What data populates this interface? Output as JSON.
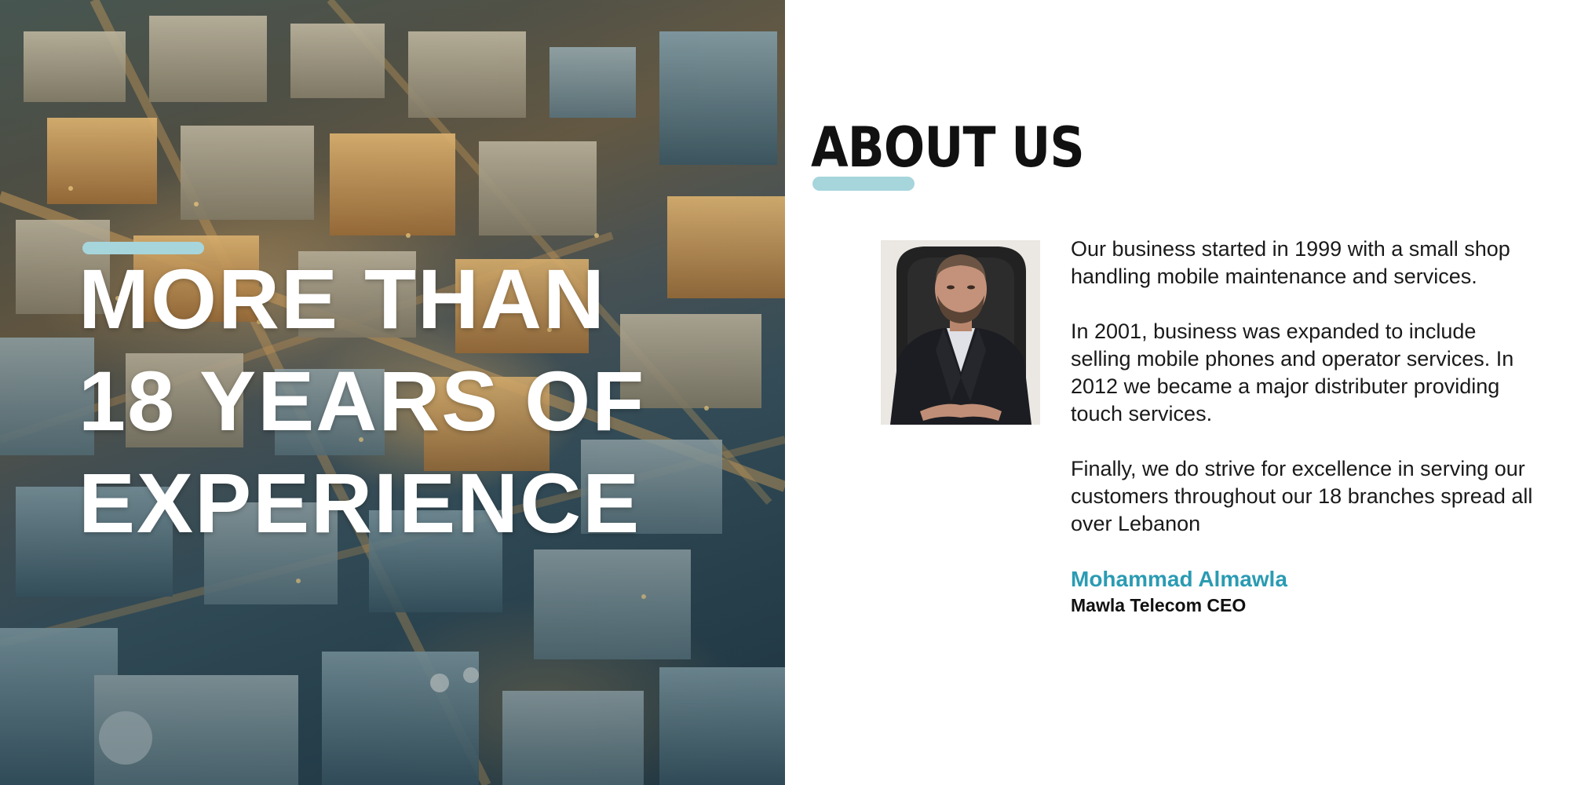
{
  "hero": {
    "image_icon": "city-aerial-photo",
    "headline_lines": [
      "MORE THAN",
      "18 YEARS OF",
      "EXPERIENCE"
    ]
  },
  "about": {
    "title": "ABOUT US",
    "paragraphs": [
      "Our business started in 1999 with a small shop handling mobile maintenance and services.",
      "In 2001, business was expanded to include selling mobile phones and operator services. In 2012 we became a major distributer providing touch services.",
      "Finally, we do strive for excellence in serving our customers throughout our 18 branches spread all over Lebanon"
    ],
    "ceo": {
      "photo_icon": "ceo-portrait-photo",
      "name": "Mohammad Almawla",
      "role": "Mawla Telecom CEO"
    }
  },
  "colors": {
    "accent": "#a6d5dc",
    "name_color": "#2b9bb3",
    "text": "#1a1a1a"
  }
}
